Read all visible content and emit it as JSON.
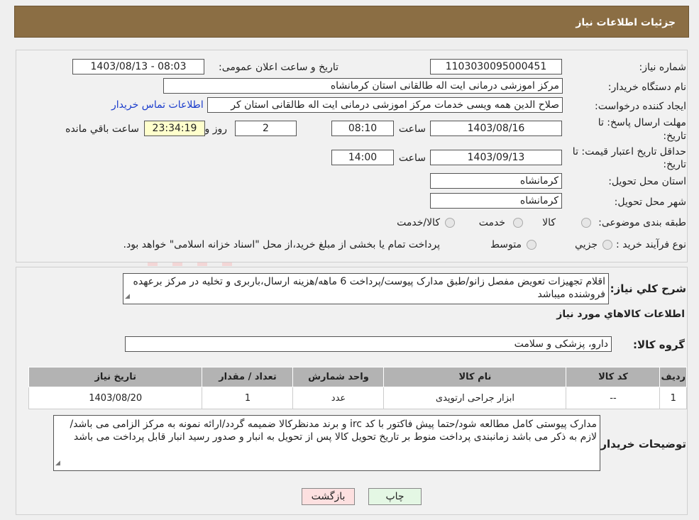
{
  "header": {
    "title": "جزئیات اطلاعات نیاز"
  },
  "need_number": {
    "label": "شماره نیاز:",
    "value": "1103030095000451"
  },
  "announce": {
    "label": "تاریخ و ساعت اعلان عمومی:",
    "value": "1403/08/13 - 08:03"
  },
  "buyer_org": {
    "label": "نام دستگاه خریدار:",
    "value": "مرکز اموزشی درمانی ایت اله طالقانی استان کرمانشاه"
  },
  "creator": {
    "label": "ایجاد کننده درخواست:",
    "value": "صلاح الدین همه ویسی خدمات مرکز اموزشی درمانی ایت اله طالقانی استان کر",
    "contact_link": "اطلاعات تماس خریدار"
  },
  "reply_deadline": {
    "label_line1": "مهلت ارسال پاسخ: تا",
    "label_line2": "تاریخ:",
    "date": "1403/08/16",
    "time_label": "ساعت",
    "time": "08:10",
    "days": "2",
    "days_label": "روز و",
    "remaining": "23:34:19",
    "remaining_label": "ساعت باقي مانده"
  },
  "price_validity": {
    "label_line1": "حداقل تاریخ اعتبار قیمت: تا",
    "label_line2": "تاریخ:",
    "date": "1403/09/13",
    "time_label": "ساعت",
    "time": "14:00"
  },
  "delivery_province": {
    "label": "استان محل تحویل:",
    "value": "کرمانشاه"
  },
  "delivery_city": {
    "label": "شهر محل تحویل:",
    "value": "کرمانشاه"
  },
  "category": {
    "label": "طبقه بندی موضوعی:",
    "options": [
      "کالا",
      "خدمت",
      "کالا/خدمت"
    ]
  },
  "purchase_type": {
    "label": "نوع فرآیند خرید :",
    "options": [
      "جزیي",
      "متوسط"
    ],
    "note": "پرداخت تمام یا بخشی از مبلغ خرید،از محل \"اسناد خزانه اسلامی\" خواهد بود."
  },
  "description": {
    "label": "شرح کلي نياز:",
    "value": "اقلام تجهیزات تعویض مفصل زانو/طبق مدارک پیوست/پرداخت 6 ماهه/هزینه ارسال،باربری و تخلیه در مرکز برعهده فروشنده میباشد"
  },
  "goods_info_title": "اطلاعات کالاهاي مورد نياز",
  "goods_group": {
    "label": "گروه کالا:",
    "value": "دارو، پزشکی و سلامت"
  },
  "table": {
    "headers": [
      "رديف",
      "کد کالا",
      "نام کالا",
      "واحد شمارش",
      "تعداد / مقدار",
      "تاريخ نياز"
    ],
    "rows": [
      {
        "row": "1",
        "code": "--",
        "name": "ابزار جراحی ارتوپدی",
        "unit": "عدد",
        "qty": "1",
        "date": "1403/08/20"
      }
    ]
  },
  "buyer_notes": {
    "label": "توضیحات خریدار:",
    "value": "مدارک پیوستی کامل مطالعه شود/حتما پیش فاکتور با کد irc و برند مدنظرکالا ضمیمه گردد/ارائه نمونه به مرکز الزامی می باشد/لازم به ذکر می باشد زمانبندی پرداخت منوط بر تاریخ تحویل کالا  پس از تحویل به انبار و صدور رسید انبار قابل پرداخت می باشد"
  },
  "buttons": {
    "print": "چاپ",
    "back": "بازگشت"
  },
  "colors": {
    "header_bg": "#8b6e44",
    "table_header_bg": "#b3b3b3",
    "back_button_bg": "#fde0e0",
    "print_button_bg": "#e4f7e4",
    "watermark": "#f4dada"
  }
}
